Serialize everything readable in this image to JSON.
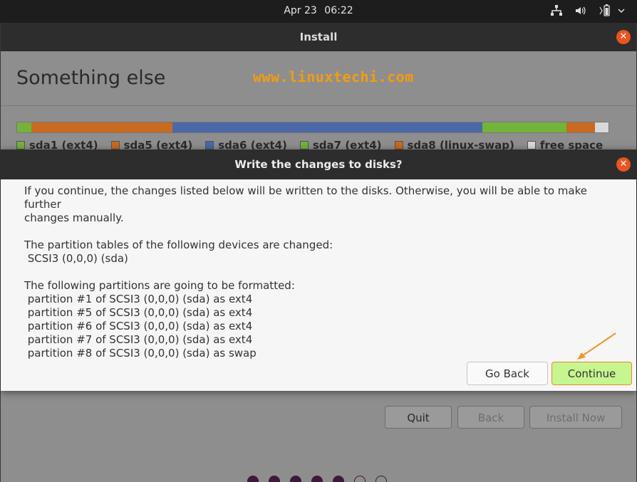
{
  "topbar": {
    "date": "Apr 23",
    "time": "06:22"
  },
  "icons": {
    "network": "network-icon",
    "volume": "volume-icon",
    "battery": "battery-icon",
    "close": "close-icon"
  },
  "window": {
    "title": "Install",
    "heading": "Something else",
    "watermark": "www.linuxtechi.com"
  },
  "partition_bar": {
    "segments": [
      {
        "name": "sda1",
        "color": "#73b33a",
        "fraction": 0.025
      },
      {
        "name": "sda5",
        "color": "#c86a1f",
        "fraction": 0.245
      },
      {
        "name": "sda6",
        "color": "#4b68a8",
        "fraction": 0.54
      },
      {
        "name": "sda7",
        "color": "#73b33a",
        "fraction": 0.147
      },
      {
        "name": "sda8",
        "color": "#c86a1f",
        "fraction": 0.05
      },
      {
        "name": "free",
        "color": "#d8d8d8",
        "fraction": 0.023
      }
    ],
    "legend": [
      {
        "label": "sda1 (ext4)",
        "color": "#73b33a"
      },
      {
        "label": "sda5 (ext4)",
        "color": "#c86a1f"
      },
      {
        "label": "sda6 (ext4)",
        "color": "#4b68a8"
      },
      {
        "label": "sda7 (ext4)",
        "color": "#73b33a"
      },
      {
        "label": "sda8 (linux-swap)",
        "color": "#c86a1f"
      },
      {
        "label": "free space",
        "color": "#d8d8d8"
      }
    ]
  },
  "bottom_buttons": {
    "quit": "Quit",
    "back": "Back",
    "install_now": "Install Now"
  },
  "dialog": {
    "title": "Write the changes to disks?",
    "intro_line1": "If you continue, the changes listed below will be written to the disks. Otherwise, you will be able to make further",
    "intro_line2": "changes manually.",
    "tables_heading": "The partition tables of the following devices are changed:",
    "device": " SCSI3 (0,0,0) (sda)",
    "format_heading": "The following partitions are going to be formatted:",
    "partitions": [
      " partition #1 of SCSI3 (0,0,0) (sda) as ext4",
      " partition #5 of SCSI3 (0,0,0) (sda) as ext4",
      " partition #6 of SCSI3 (0,0,0) (sda) as ext4",
      " partition #7 of SCSI3 (0,0,0) (sda) as ext4",
      " partition #8 of SCSI3 (0,0,0) (sda) as swap"
    ],
    "go_back": "Go Back",
    "continue": "Continue"
  },
  "colors": {
    "accent": "#e95420",
    "watermark": "#f39c12",
    "continue_bg": "#c7f58f",
    "step_dot": "#3d1a3a"
  }
}
